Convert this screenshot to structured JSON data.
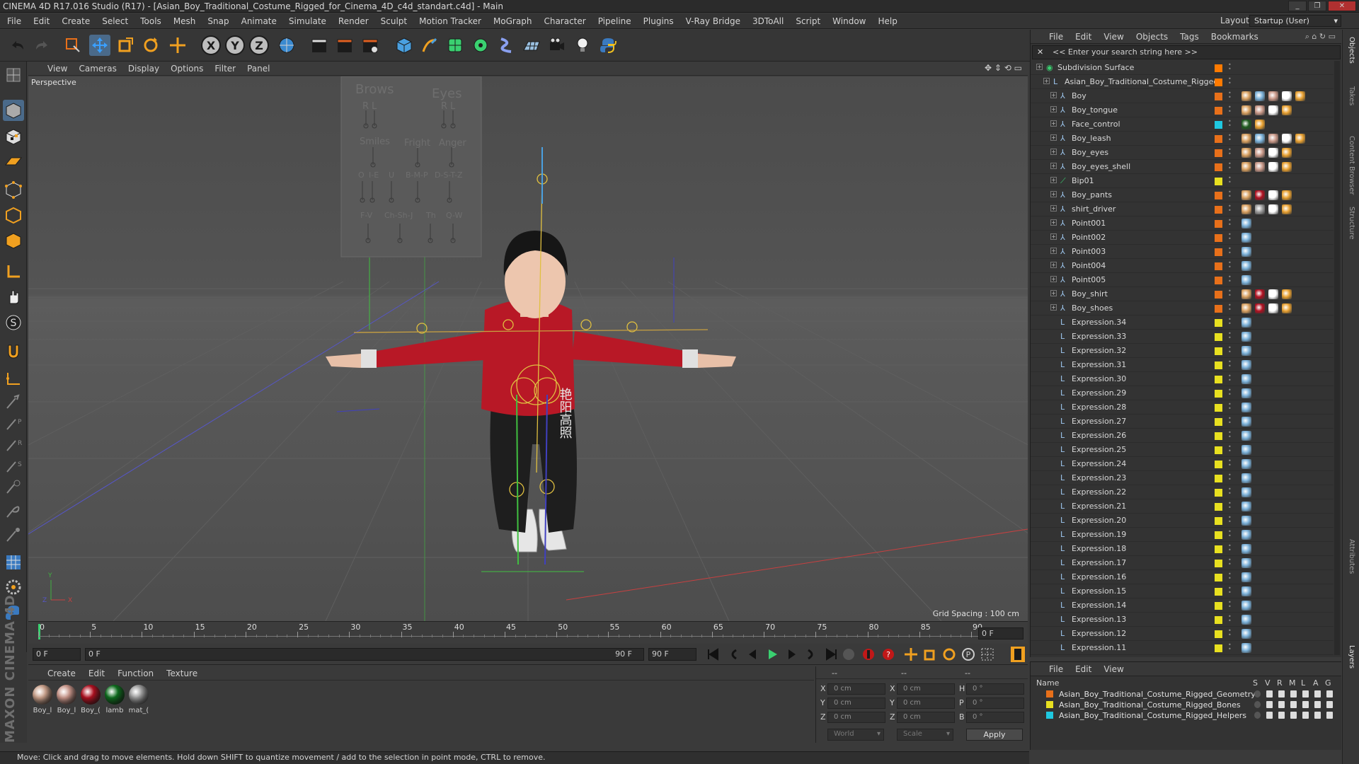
{
  "window": {
    "title": "CINEMA 4D R17.016 Studio (R17) - [Asian_Boy_Traditional_Costume_Rigged_for_Cinema_4D_c4d_standart.c4d] - Main",
    "buttons": [
      "_",
      "❐",
      "✕"
    ]
  },
  "menubar": {
    "items": [
      "File",
      "Edit",
      "Create",
      "Select",
      "Tools",
      "Mesh",
      "Snap",
      "Animate",
      "Simulate",
      "Render",
      "Sculpt",
      "Motion Tracker",
      "MoGraph",
      "Character",
      "Pipeline",
      "Plugins",
      "V-Ray Bridge",
      "3DToAll",
      "Script",
      "Window",
      "Help"
    ],
    "layout_label": "Layout:",
    "layout_value": "Startup (User)"
  },
  "toolbar": {
    "axis_x": "X",
    "axis_y": "Y",
    "axis_z": "Z"
  },
  "viewport": {
    "menu": [
      "View",
      "Cameras",
      "Display",
      "Options",
      "Filter",
      "Panel"
    ],
    "label": "Perspective",
    "grid_spacing": "Grid Spacing : 100 cm",
    "facial_labels": {
      "brows": "Brows",
      "eyes": "Eyes",
      "r1": "R",
      "l1": "L",
      "r2": "R",
      "l2": "L",
      "smiles": "Smiles",
      "fright": "Fright",
      "anger": "Anger",
      "o": "O",
      "ie": "I-E",
      "u": "U",
      "bmp": "B-M-P",
      "dstz": "D-S-T-Z",
      "fv": "F-V",
      "chshj": "Ch-Sh-J",
      "th": "Th",
      "qw": "Q-W"
    },
    "shirt_text": "艳阳高照"
  },
  "timeline": {
    "ticks": [
      "0",
      "5",
      "10",
      "15",
      "20",
      "25",
      "30",
      "35",
      "40",
      "45",
      "50",
      "55",
      "60",
      "65",
      "70",
      "75",
      "80",
      "85",
      "90"
    ],
    "frame_end_field": "0 F",
    "start_field": "0 F",
    "range_start": "0 F",
    "range_end": "90 F",
    "end_field": "90 F"
  },
  "materials": {
    "menu": [
      "Create",
      "Edit",
      "Function",
      "Texture"
    ],
    "items": [
      {
        "name": "Boy_l",
        "color": "#c9a08a"
      },
      {
        "name": "Boy_l",
        "color": "#c9968a"
      },
      {
        "name": "Boy_(",
        "color": "#b01020"
      },
      {
        "name": "lamb",
        "color": "#0d6d1d"
      },
      {
        "name": "mat_(",
        "color": "#9a9a9a"
      }
    ]
  },
  "coordinates": {
    "header": [
      "--",
      "--",
      "--"
    ],
    "rows": [
      {
        "a": "X",
        "v1": "0 cm",
        "b": "X",
        "v2": "0 cm",
        "c": "H",
        "v3": "0 °"
      },
      {
        "a": "Y",
        "v1": "0 cm",
        "b": "Y",
        "v2": "0 cm",
        "c": "P",
        "v3": "0 °"
      },
      {
        "a": "Z",
        "v1": "0 cm",
        "b": "Z",
        "v2": "0 cm",
        "c": "B",
        "v3": "0 °"
      }
    ],
    "mode1": "World",
    "mode2": "Scale",
    "apply": "Apply"
  },
  "status": "Move: Click and drag to move elements. Hold down SHIFT to quantize movement / add to the selection in point mode, CTRL to remove.",
  "maxon_logo": "MAXON CINEMA 4D",
  "object_manager": {
    "menu": [
      "File",
      "Edit",
      "View",
      "Objects",
      "Tags",
      "Bookmarks"
    ],
    "search_placeholder": "<< Enter your search string here >>",
    "objects": [
      {
        "name": "Subdivision Surface",
        "depth": 0,
        "layer": "#ff7a00",
        "icon": "green",
        "tags": []
      },
      {
        "name": "Asian_Boy_Traditional_Costume_Rigged",
        "depth": 1,
        "layer": "#ff7a00",
        "icon": "null",
        "tags": []
      },
      {
        "name": "Boy",
        "depth": 2,
        "layer": "#e8701a",
        "icon": "bone",
        "tags": [
          "#d8a060",
          "#7ab0d8",
          "#c89888",
          "#ffffff",
          "#e8a030"
        ]
      },
      {
        "name": "Boy_tongue",
        "depth": 2,
        "layer": "#e8701a",
        "icon": "bone",
        "tags": [
          "#d8a060",
          "#c89888",
          "#ffffff",
          "#e8a030"
        ]
      },
      {
        "name": "Face_control",
        "depth": 2,
        "layer": "#1fc8e0",
        "icon": "bone",
        "tags": [
          "#1f5a1f",
          "#e8a030"
        ]
      },
      {
        "name": "Boy_leash",
        "depth": 2,
        "layer": "#e8701a",
        "icon": "bone",
        "tags": [
          "#d8a060",
          "#7ab0d8",
          "#c89888",
          "#ffffff",
          "#e8a030"
        ]
      },
      {
        "name": "Boy_eyes",
        "depth": 2,
        "layer": "#e8701a",
        "icon": "bone",
        "tags": [
          "#d8a060",
          "#c89888",
          "#ffffff",
          "#e8a030"
        ]
      },
      {
        "name": "Boy_eyes_shell",
        "depth": 2,
        "layer": "#e8701a",
        "icon": "bone",
        "tags": [
          "#d8a060",
          "#c89888",
          "#ffffff",
          "#e8a030"
        ]
      },
      {
        "name": "Bip01",
        "depth": 2,
        "layer": "#e8e020",
        "icon": "bip",
        "tags": []
      },
      {
        "name": "Boy_pants",
        "depth": 2,
        "layer": "#e8701a",
        "icon": "bone",
        "tags": [
          "#d8a060",
          "#b01020",
          "#ffffff",
          "#e8a030"
        ]
      },
      {
        "name": "shirt_driver",
        "depth": 2,
        "layer": "#e8701a",
        "icon": "bone",
        "tags": [
          "#d8a060",
          "#9a9a9a",
          "#ffffff",
          "#e8a030"
        ]
      },
      {
        "name": "Point001",
        "depth": 2,
        "layer": "#e8701a",
        "icon": "bone",
        "tags": [
          "#7ab0d8"
        ]
      },
      {
        "name": "Point002",
        "depth": 2,
        "layer": "#e8701a",
        "icon": "bone",
        "tags": [
          "#7ab0d8"
        ]
      },
      {
        "name": "Point003",
        "depth": 2,
        "layer": "#e8701a",
        "icon": "bone",
        "tags": [
          "#7ab0d8"
        ]
      },
      {
        "name": "Point004",
        "depth": 2,
        "layer": "#e8701a",
        "icon": "bone",
        "tags": [
          "#7ab0d8"
        ]
      },
      {
        "name": "Point005",
        "depth": 2,
        "layer": "#e8701a",
        "icon": "bone",
        "tags": [
          "#7ab0d8"
        ]
      },
      {
        "name": "Boy_shirt",
        "depth": 2,
        "layer": "#e8701a",
        "icon": "bone",
        "tags": [
          "#d8a060",
          "#b01020",
          "#ffffff",
          "#e8a030"
        ]
      },
      {
        "name": "Boy_shoes",
        "depth": 2,
        "layer": "#e8701a",
        "icon": "bone",
        "tags": [
          "#d8a060",
          "#b01020",
          "#ffffff",
          "#e8a030"
        ]
      },
      {
        "name": "Expression.34",
        "depth": 2,
        "layer": "#e8e020",
        "icon": "expr",
        "tags": [
          "#7ab0d8"
        ]
      },
      {
        "name": "Expression.33",
        "depth": 2,
        "layer": "#e8e020",
        "icon": "expr",
        "tags": [
          "#7ab0d8"
        ]
      },
      {
        "name": "Expression.32",
        "depth": 2,
        "layer": "#e8e020",
        "icon": "expr",
        "tags": [
          "#7ab0d8"
        ]
      },
      {
        "name": "Expression.31",
        "depth": 2,
        "layer": "#e8e020",
        "icon": "expr",
        "tags": [
          "#7ab0d8"
        ]
      },
      {
        "name": "Expression.30",
        "depth": 2,
        "layer": "#e8e020",
        "icon": "expr",
        "tags": [
          "#7ab0d8"
        ]
      },
      {
        "name": "Expression.29",
        "depth": 2,
        "layer": "#e8e020",
        "icon": "expr",
        "tags": [
          "#7ab0d8"
        ]
      },
      {
        "name": "Expression.28",
        "depth": 2,
        "layer": "#e8e020",
        "icon": "expr",
        "tags": [
          "#7ab0d8"
        ]
      },
      {
        "name": "Expression.27",
        "depth": 2,
        "layer": "#e8e020",
        "icon": "expr",
        "tags": [
          "#7ab0d8"
        ]
      },
      {
        "name": "Expression.26",
        "depth": 2,
        "layer": "#e8e020",
        "icon": "expr",
        "tags": [
          "#7ab0d8"
        ]
      },
      {
        "name": "Expression.25",
        "depth": 2,
        "layer": "#e8e020",
        "icon": "expr",
        "tags": [
          "#7ab0d8"
        ]
      },
      {
        "name": "Expression.24",
        "depth": 2,
        "layer": "#e8e020",
        "icon": "expr",
        "tags": [
          "#7ab0d8"
        ]
      },
      {
        "name": "Expression.23",
        "depth": 2,
        "layer": "#e8e020",
        "icon": "expr",
        "tags": [
          "#7ab0d8"
        ]
      },
      {
        "name": "Expression.22",
        "depth": 2,
        "layer": "#e8e020",
        "icon": "expr",
        "tags": [
          "#7ab0d8"
        ]
      },
      {
        "name": "Expression.21",
        "depth": 2,
        "layer": "#e8e020",
        "icon": "expr",
        "tags": [
          "#7ab0d8"
        ]
      },
      {
        "name": "Expression.20",
        "depth": 2,
        "layer": "#e8e020",
        "icon": "expr",
        "tags": [
          "#7ab0d8"
        ]
      },
      {
        "name": "Expression.19",
        "depth": 2,
        "layer": "#e8e020",
        "icon": "expr",
        "tags": [
          "#7ab0d8"
        ]
      },
      {
        "name": "Expression.18",
        "depth": 2,
        "layer": "#e8e020",
        "icon": "expr",
        "tags": [
          "#7ab0d8"
        ]
      },
      {
        "name": "Expression.17",
        "depth": 2,
        "layer": "#e8e020",
        "icon": "expr",
        "tags": [
          "#7ab0d8"
        ]
      },
      {
        "name": "Expression.16",
        "depth": 2,
        "layer": "#e8e020",
        "icon": "expr",
        "tags": [
          "#7ab0d8"
        ]
      },
      {
        "name": "Expression.15",
        "depth": 2,
        "layer": "#e8e020",
        "icon": "expr",
        "tags": [
          "#7ab0d8"
        ]
      },
      {
        "name": "Expression.14",
        "depth": 2,
        "layer": "#e8e020",
        "icon": "expr",
        "tags": [
          "#7ab0d8"
        ]
      },
      {
        "name": "Expression.13",
        "depth": 2,
        "layer": "#e8e020",
        "icon": "expr",
        "tags": [
          "#7ab0d8"
        ]
      },
      {
        "name": "Expression.12",
        "depth": 2,
        "layer": "#e8e020",
        "icon": "expr",
        "tags": [
          "#7ab0d8"
        ]
      },
      {
        "name": "Expression.11",
        "depth": 2,
        "layer": "#e8e020",
        "icon": "expr",
        "tags": [
          "#7ab0d8"
        ]
      }
    ]
  },
  "layer_manager": {
    "menu": [
      "File",
      "Edit",
      "View"
    ],
    "name_header": "Name",
    "col_headers": [
      "S",
      "V",
      "R",
      "M",
      "L",
      "A",
      "G"
    ],
    "layers": [
      {
        "name": "Asian_Boy_Traditional_Costume_Rigged_Geometry",
        "color": "#e8701a"
      },
      {
        "name": "Asian_Boy_Traditional_Costume_Rigged_Bones",
        "color": "#e8e020"
      },
      {
        "name": "Asian_Boy_Traditional_Costume_Rigged_Helpers",
        "color": "#1fc8e0"
      }
    ]
  },
  "right_tabs": [
    "Objects",
    "Takes",
    "Content Browser",
    "Structure",
    "Attributes",
    "Layers"
  ]
}
